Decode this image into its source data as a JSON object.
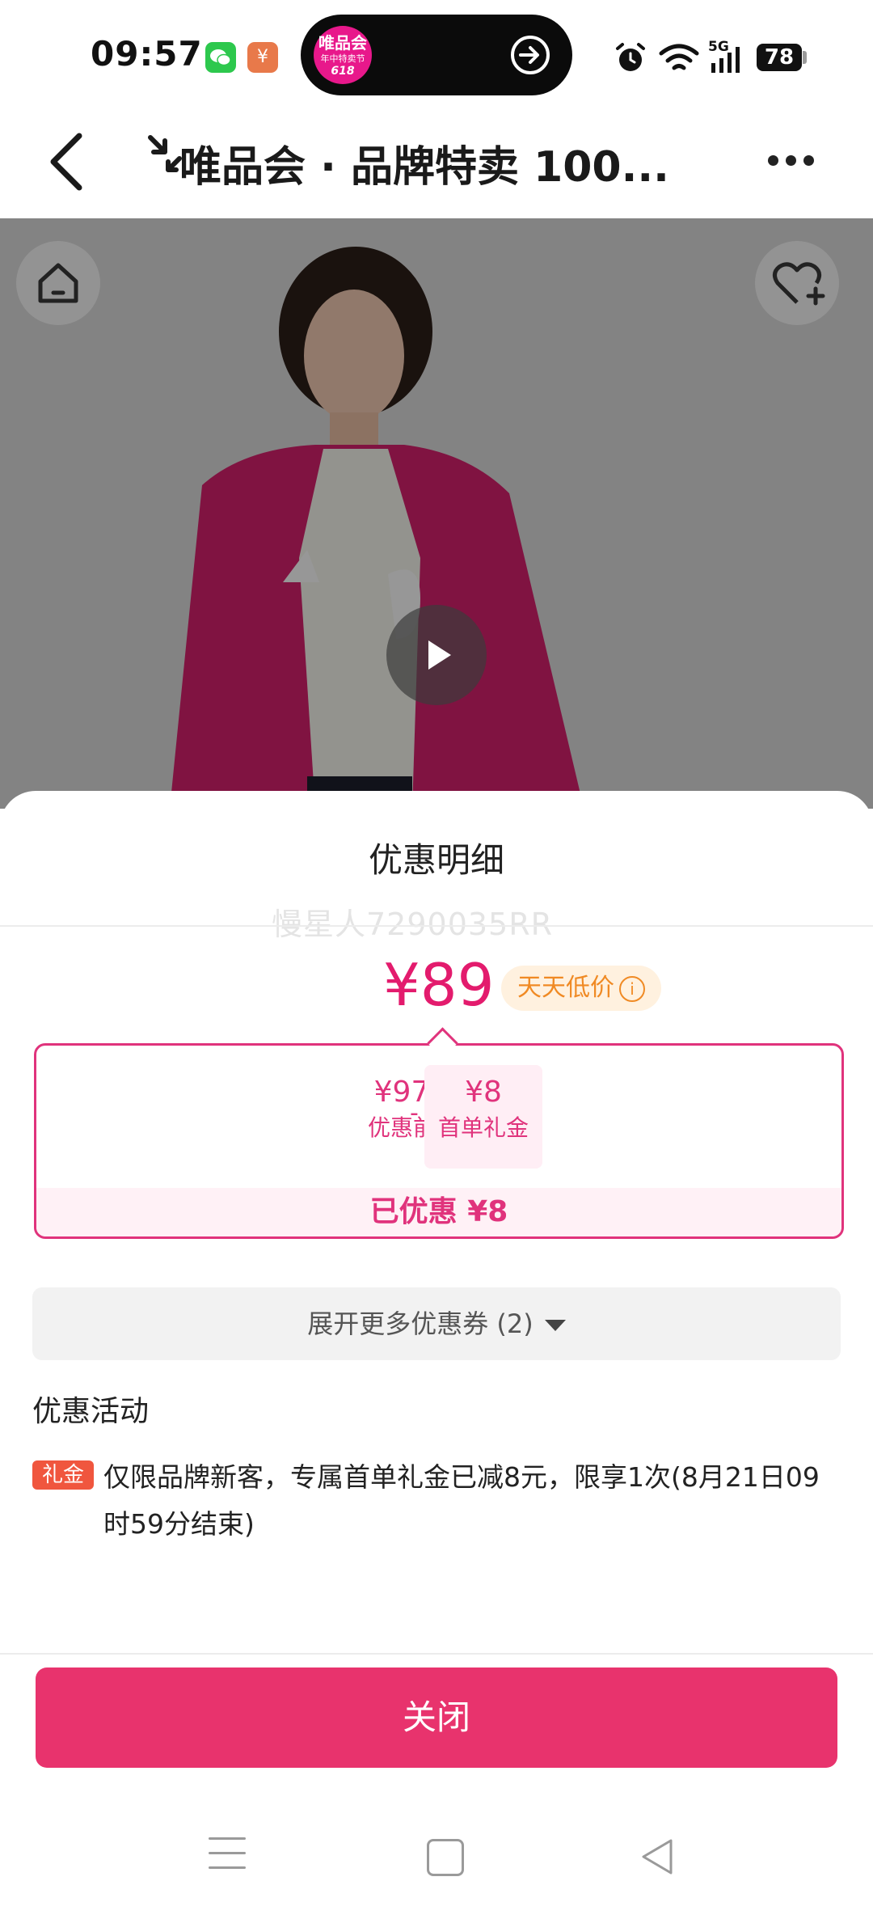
{
  "status_bar": {
    "time": "09:57",
    "app_icons": [
      "wechat-icon",
      "wallet-icon"
    ],
    "pill_logo": {
      "line1": "唯品会",
      "line2": "年中特卖节",
      "line3": "618"
    },
    "network": "5G",
    "battery": "78"
  },
  "nav": {
    "title": "唯品会 · 品牌特卖 100..."
  },
  "sheet": {
    "title": "优惠明细",
    "watermark": "慢星人7290035RR",
    "price": "¥89",
    "low_price_badge": "天天低价",
    "breakdown": {
      "before_value": "¥97",
      "before_label": "优惠前",
      "minus": "-",
      "gift_value": "¥8",
      "gift_label": "首单礼金",
      "saved": "已优惠 ¥8"
    },
    "expand_label": "展开更多优惠券 (2)",
    "section_title": "优惠活动",
    "promo": {
      "tag": "礼金",
      "text": "仅限品牌新客，专属首单礼金已减8元，限享1次(8月21日09时59分结束)"
    },
    "close_label": "关闭"
  },
  "colors": {
    "accent": "#e31b6d",
    "close_button": "#e8336d",
    "badge_bg": "#fff1df",
    "badge_text": "#f08a24",
    "gift_tag": "#f0563e"
  }
}
